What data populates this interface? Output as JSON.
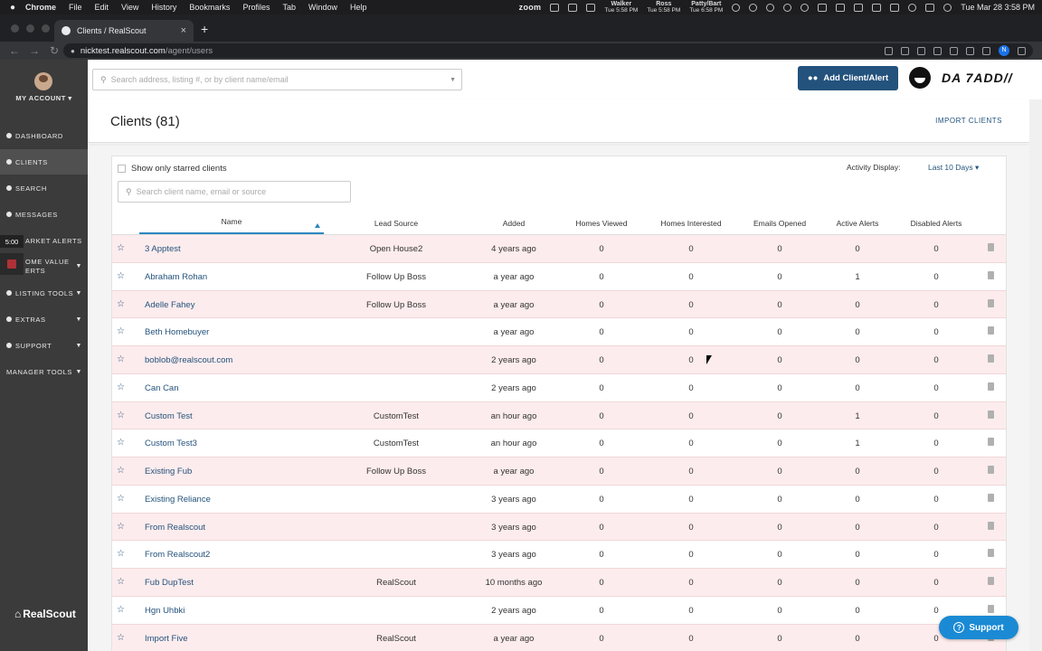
{
  "os_menubar": {
    "app": "Chrome",
    "items": [
      "File",
      "Edit",
      "View",
      "History",
      "Bookmarks",
      "Profiles",
      "Tab",
      "Window",
      "Help"
    ],
    "zoom": "zoom",
    "clocks": [
      {
        "name": "Walker",
        "time": "Tue 5:58 PM"
      },
      {
        "name": "Ross",
        "time": "Tue 5:58 PM"
      },
      {
        "name": "Patty/Bart",
        "time": "Tue 6:58 PM"
      }
    ],
    "datetime": "Tue Mar 28  3:58 PM"
  },
  "browser": {
    "tab_title": "Clients / RealScout",
    "url_host": "nicktest.realscout.com",
    "url_path": "/agent/users",
    "profile_initial": "N"
  },
  "sidebar": {
    "account_label": "MY ACCOUNT",
    "timer": "5:00",
    "items": [
      {
        "label": "DASHBOARD"
      },
      {
        "label": "CLIENTS"
      },
      {
        "label": "SEARCH"
      },
      {
        "label": "MESSAGES"
      },
      {
        "label": "ARKET ALERTS"
      },
      {
        "label": "OME VALUE ERTS"
      },
      {
        "label": "LISTING TOOLS"
      },
      {
        "label": "EXTRAS"
      },
      {
        "label": "SUPPORT"
      },
      {
        "label": "MANAGER TOOLS"
      }
    ],
    "logo_text": "RealScout"
  },
  "topbar": {
    "search_placeholder": "Search address, listing #, or by client name/email",
    "add_button": "Add Client/Alert",
    "brand_text": "DA 7ADD//"
  },
  "page": {
    "title": "Clients (81)",
    "import_button": "IMPORT CLIENTS",
    "starred_label": "Show only starred clients",
    "activity_label": "Activity Display:",
    "activity_value": "Last 10 Days",
    "client_search_placeholder": "Search client name, email or source"
  },
  "table": {
    "headers": [
      "Name",
      "Lead Source",
      "Added",
      "Homes Viewed",
      "Homes Interested",
      "Emails Opened",
      "Active Alerts",
      "Disabled Alerts"
    ],
    "rows": [
      {
        "name": "3 Apptest",
        "source": "Open House2",
        "added": "4 years ago",
        "viewed": "0",
        "interested": "0",
        "emails": "0",
        "active": "0",
        "disabled": "0"
      },
      {
        "name": "Abraham Rohan",
        "source": "Follow Up Boss",
        "added": "a year ago",
        "viewed": "0",
        "interested": "0",
        "emails": "0",
        "active": "1",
        "disabled": "0"
      },
      {
        "name": "Adelle Fahey",
        "source": "Follow Up Boss",
        "added": "a year ago",
        "viewed": "0",
        "interested": "0",
        "emails": "0",
        "active": "0",
        "disabled": "0"
      },
      {
        "name": "Beth Homebuyer",
        "source": "",
        "added": "a year ago",
        "viewed": "0",
        "interested": "0",
        "emails": "0",
        "active": "0",
        "disabled": "0"
      },
      {
        "name": "boblob@realscout.com",
        "source": "",
        "added": "2 years ago",
        "viewed": "0",
        "interested": "0",
        "emails": "0",
        "active": "0",
        "disabled": "0"
      },
      {
        "name": "Can Can",
        "source": "",
        "added": "2 years ago",
        "viewed": "0",
        "interested": "0",
        "emails": "0",
        "active": "0",
        "disabled": "0"
      },
      {
        "name": "Custom Test",
        "source": "CustomTest",
        "added": "an hour ago",
        "viewed": "0",
        "interested": "0",
        "emails": "0",
        "active": "1",
        "disabled": "0"
      },
      {
        "name": "Custom Test3",
        "source": "CustomTest",
        "added": "an hour ago",
        "viewed": "0",
        "interested": "0",
        "emails": "0",
        "active": "1",
        "disabled": "0"
      },
      {
        "name": "Existing Fub",
        "source": "Follow Up Boss",
        "added": "a year ago",
        "viewed": "0",
        "interested": "0",
        "emails": "0",
        "active": "0",
        "disabled": "0"
      },
      {
        "name": "Existing Reliance",
        "source": "",
        "added": "3 years ago",
        "viewed": "0",
        "interested": "0",
        "emails": "0",
        "active": "0",
        "disabled": "0"
      },
      {
        "name": "From Realscout",
        "source": "",
        "added": "3 years ago",
        "viewed": "0",
        "interested": "0",
        "emails": "0",
        "active": "0",
        "disabled": "0"
      },
      {
        "name": "From Realscout2",
        "source": "",
        "added": "3 years ago",
        "viewed": "0",
        "interested": "0",
        "emails": "0",
        "active": "0",
        "disabled": "0"
      },
      {
        "name": "Fub DupTest",
        "source": "RealScout",
        "added": "10 months ago",
        "viewed": "0",
        "interested": "0",
        "emails": "0",
        "active": "0",
        "disabled": "0"
      },
      {
        "name": "Hgn Uhbki",
        "source": "",
        "added": "2 years ago",
        "viewed": "0",
        "interested": "0",
        "emails": "0",
        "active": "0",
        "disabled": "0"
      },
      {
        "name": "Import Five",
        "source": "RealScout",
        "added": "a year ago",
        "viewed": "0",
        "interested": "0",
        "emails": "0",
        "active": "0",
        "disabled": "0"
      }
    ]
  },
  "support_button": "Support",
  "colors": {
    "accent": "#23527c",
    "row_pink": "#fdeced",
    "sidebar_bg": "#3b3b3b",
    "support_blue": "#1a8ad4"
  }
}
